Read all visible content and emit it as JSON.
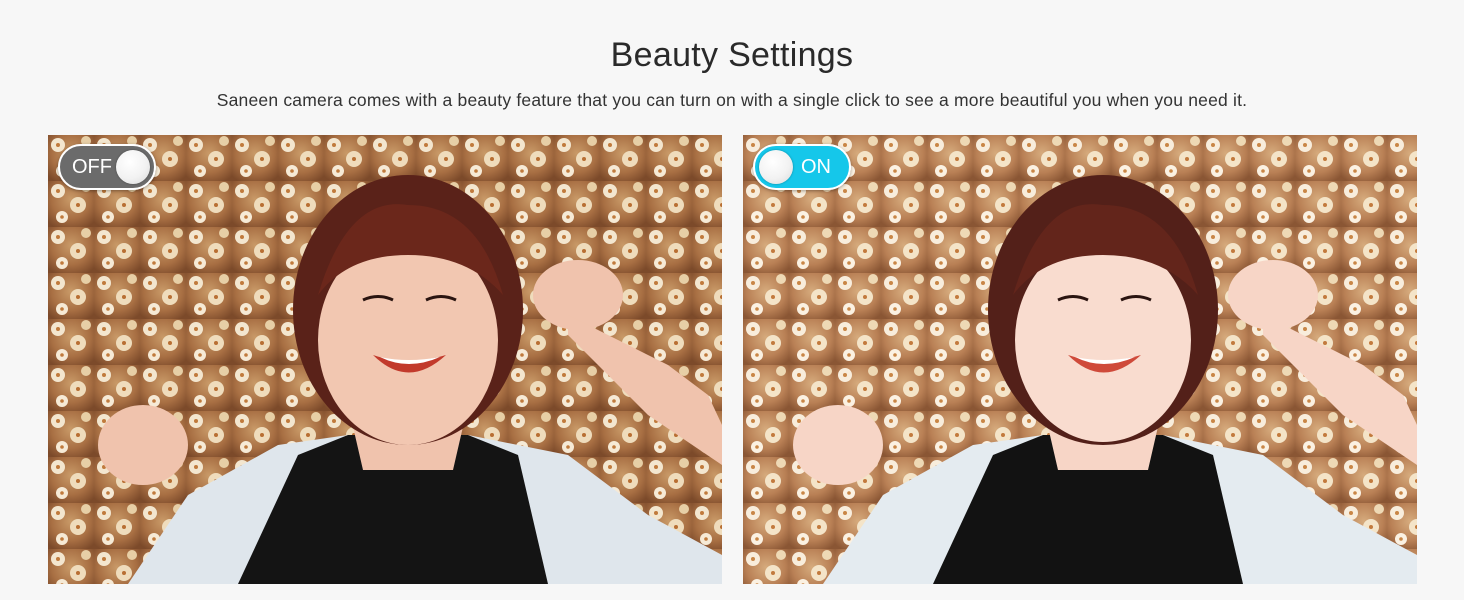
{
  "header": {
    "title": "Beauty Settings",
    "subtitle": "Saneen camera comes with a beauty feature that you can turn on with a single click to see a more beautiful you when you need it."
  },
  "panels": [
    {
      "toggle_label": "OFF",
      "toggle_state": "off"
    },
    {
      "toggle_label": "ON",
      "toggle_state": "on"
    }
  ],
  "colors": {
    "toggle_off": "#6b6b6b",
    "toggle_on": "#15c7ea",
    "background": "#f7f7f7"
  }
}
